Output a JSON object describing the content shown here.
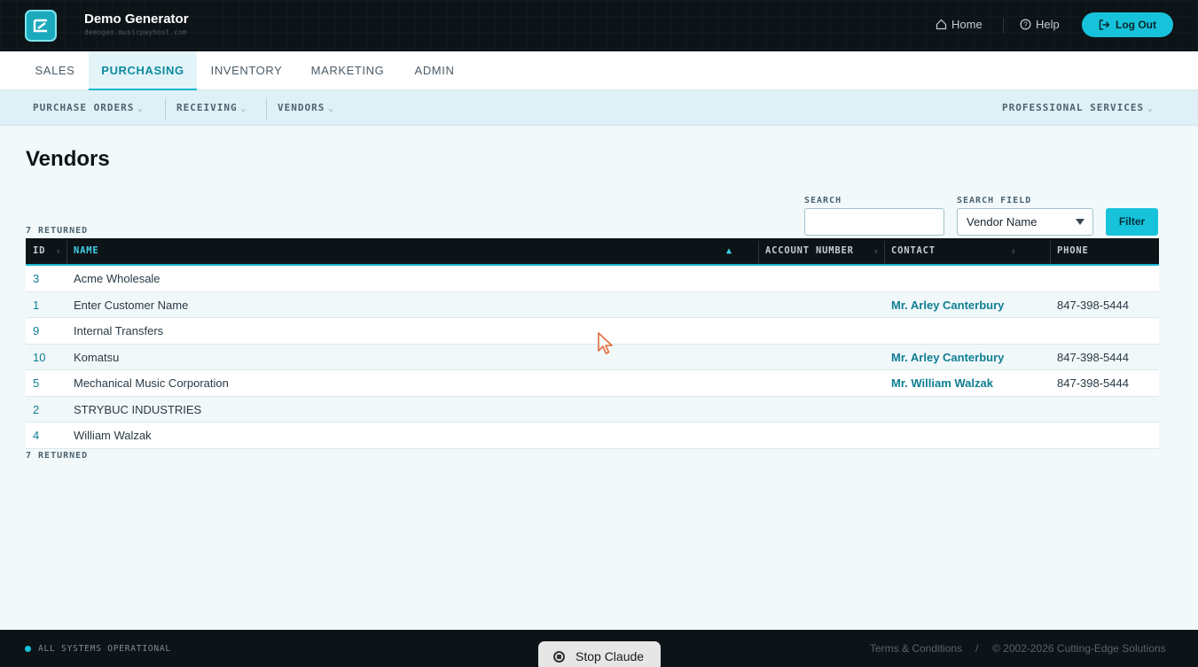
{
  "header": {
    "brand_title": "Demo Generator",
    "brand_subtitle": "demogen.musicpayhost.com",
    "home_label": "Home",
    "help_label": "Help",
    "logout_label": "Log Out"
  },
  "main_nav": {
    "tabs": [
      {
        "label": "SALES",
        "active": false
      },
      {
        "label": "PURCHASING",
        "active": true
      },
      {
        "label": "INVENTORY",
        "active": false
      },
      {
        "label": "MARKETING",
        "active": false
      },
      {
        "label": "ADMIN",
        "active": false
      }
    ]
  },
  "sub_nav": {
    "items": [
      "PURCHASE ORDERS",
      "RECEIVING",
      "VENDORS"
    ],
    "right_item": "PROFESSIONAL SERVICES"
  },
  "page": {
    "title": "Vendors",
    "returned_top": "7 RETURNED",
    "returned_bottom": "7 RETURNED"
  },
  "search": {
    "label": "SEARCH",
    "value": "",
    "field_label": "SEARCH FIELD",
    "field_value": "Vendor Name",
    "filter_label": "Filter"
  },
  "table": {
    "columns": [
      "ID",
      "NAME",
      "ACCOUNT NUMBER",
      "CONTACT",
      "PHONE"
    ],
    "sort_column": "NAME",
    "sort_direction": "ascending",
    "rows": [
      {
        "id": "3",
        "name": "Acme Wholesale",
        "account": "",
        "contact": "",
        "phone": ""
      },
      {
        "id": "1",
        "name": "Enter Customer Name",
        "account": "",
        "contact": "Mr. Arley Canterbury",
        "phone": "847-398-5444"
      },
      {
        "id": "9",
        "name": "Internal Transfers",
        "account": "",
        "contact": "",
        "phone": ""
      },
      {
        "id": "10",
        "name": "Komatsu",
        "account": "",
        "contact": "Mr. Arley Canterbury",
        "phone": "847-398-5444"
      },
      {
        "id": "5",
        "name": "Mechanical Music Corporation",
        "account": "",
        "contact": "Mr. William Walzak",
        "phone": "847-398-5444"
      },
      {
        "id": "2",
        "name": "STRYBUC INDUSTRIES",
        "account": "",
        "contact": "",
        "phone": ""
      },
      {
        "id": "4",
        "name": "William Walzak",
        "account": "",
        "contact": "",
        "phone": ""
      }
    ]
  },
  "footer": {
    "status": "ALL SYSTEMS OPERATIONAL",
    "terms": "Terms & Conditions",
    "separator": "/",
    "copyright": "© 2002-2026 Cutting-Edge Solutions"
  },
  "overlay": {
    "stop_label": "Stop Claude"
  },
  "colors": {
    "accent": "#16c3db",
    "header_bg": "#0d1418",
    "link": "#0f7e93"
  }
}
